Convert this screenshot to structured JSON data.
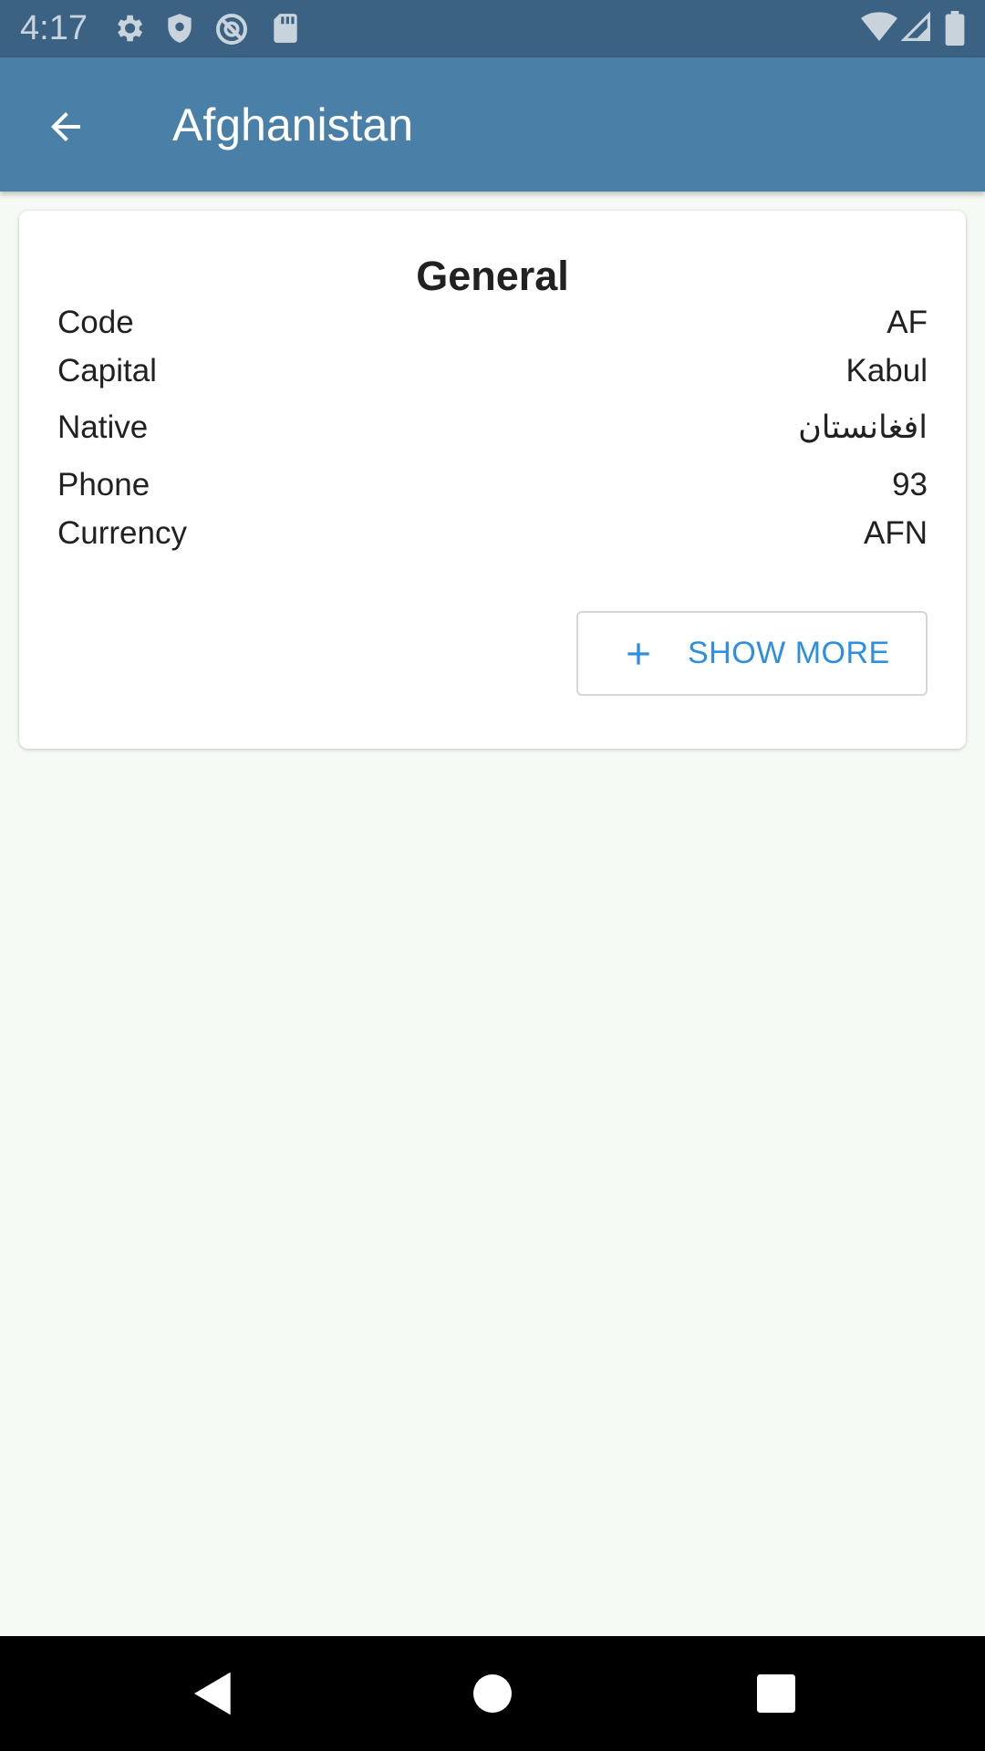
{
  "status_bar": {
    "time": "4:17",
    "left_icons": [
      "gear-icon",
      "shield-icon",
      "no-sync-icon",
      "sd-card-icon"
    ],
    "right_icons": [
      "wifi-icon",
      "signal-icon",
      "battery-icon"
    ]
  },
  "app_bar": {
    "title": "Afghanistan",
    "back_icon": "arrow-back-icon",
    "color": "#4a80a7"
  },
  "card": {
    "title": "General",
    "rows": [
      {
        "label": "Code",
        "value": "AF"
      },
      {
        "label": "Capital",
        "value": "Kabul"
      },
      {
        "label": "Native",
        "value": "افغانستان"
      },
      {
        "label": "Phone",
        "value": "93"
      },
      {
        "label": "Currency",
        "value": "AFN"
      }
    ],
    "show_more_label": "SHOW MORE",
    "show_more_icon": "plus-icon",
    "accent": "#2e8fe0"
  },
  "nav_bar": {
    "buttons": [
      "back-triangle-icon",
      "home-circle-icon",
      "recents-square-icon"
    ]
  }
}
